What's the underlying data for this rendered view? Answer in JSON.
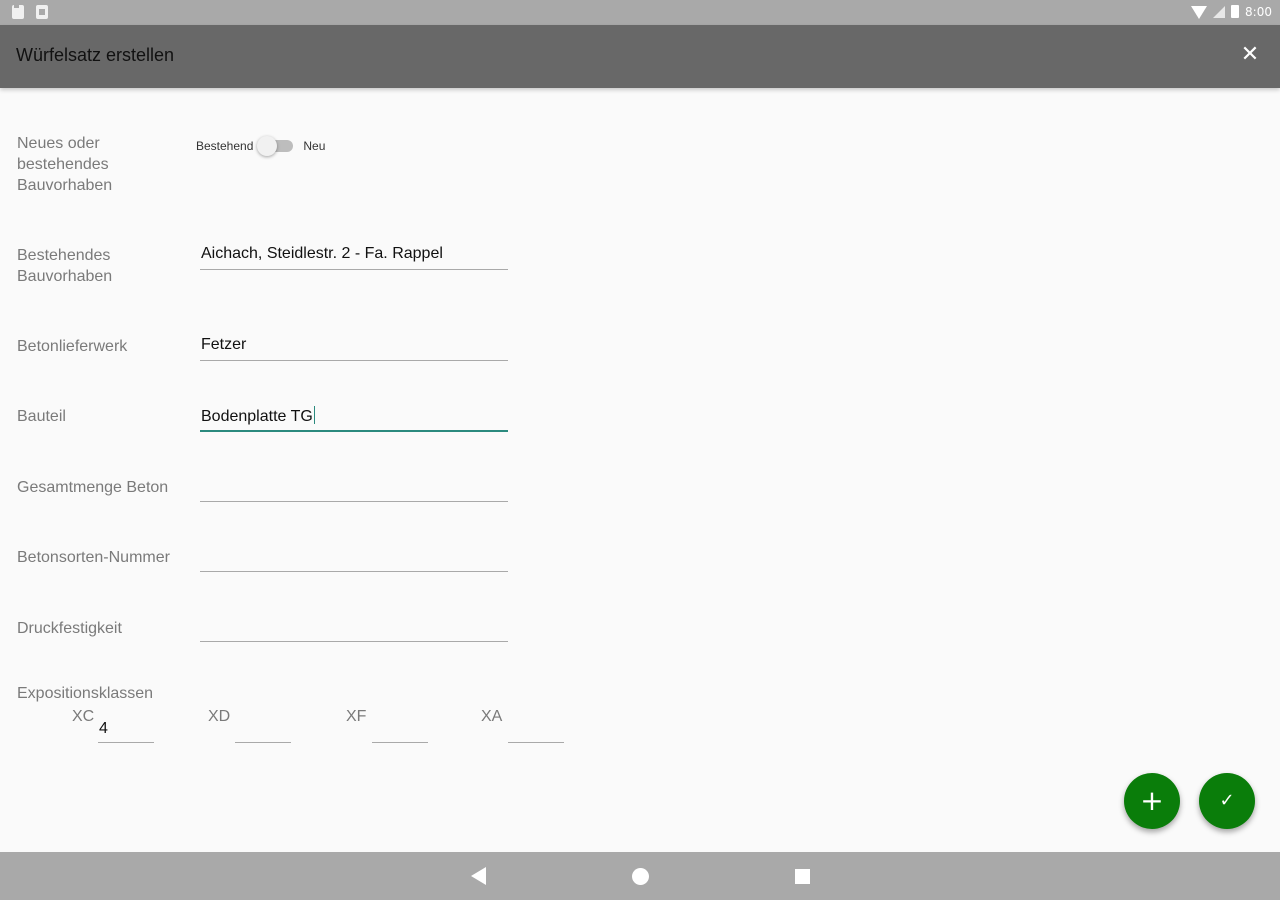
{
  "status_bar": {
    "time": "8:00"
  },
  "toolbar": {
    "title": "Würfelsatz erstellen",
    "close_icon": "close-icon"
  },
  "form": {
    "project_mode": {
      "label": "Neues oder bestehendes Bauvorhaben",
      "option_off": "Bestehend",
      "option_on": "Neu",
      "checked": false
    },
    "existing_project": {
      "label": "Bestehendes Bauvorhaben",
      "value": "Aichach, Steidlestr. 2 - Fa. Rappel"
    },
    "concrete_plant": {
      "label": "Betonlieferwerk",
      "value": "Fetzer"
    },
    "component": {
      "label": "Bauteil",
      "value": "Bodenplatte TG"
    },
    "total_concrete": {
      "label": "Gesamtmenge Beton",
      "value": ""
    },
    "concrete_type_number": {
      "label": "Betonsorten-Nummer",
      "value": ""
    },
    "compressive_strength": {
      "label": "Druckfestigkeit",
      "value": ""
    },
    "exposure_classes": {
      "label": "Expositionsklassen",
      "items": [
        {
          "label": "XC",
          "value": "4"
        },
        {
          "label": "XD",
          "value": ""
        },
        {
          "label": "XF",
          "value": ""
        },
        {
          "label": "XA",
          "value": ""
        }
      ]
    }
  },
  "fabs": {
    "add": {
      "icon": "plus-icon",
      "glyph": "+"
    },
    "confirm": {
      "icon": "check-icon",
      "glyph": "✓"
    }
  },
  "colors": {
    "accent": "#2b8a7e",
    "fab": "#0a7d0a",
    "toolbar": "#686868",
    "system_bars": "#a9a9a9"
  }
}
